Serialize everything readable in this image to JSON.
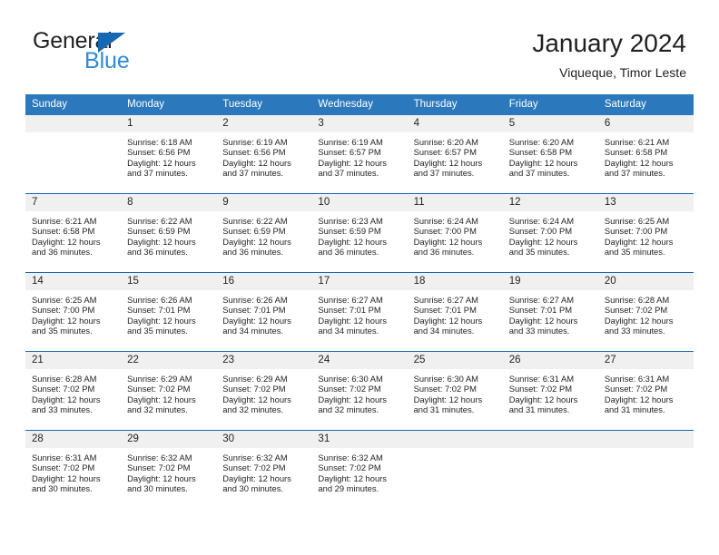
{
  "brand": {
    "name_part1": "General",
    "name_part2": "Blue",
    "logo_icon": "blue-triangle-icon",
    "accent_color": "#2e8ad6",
    "triangle_color": "#1668b3"
  },
  "header": {
    "title": "January 2024",
    "subtitle": "Viqueque, Timor Leste"
  },
  "calendar": {
    "header_bg": "#2b79bc",
    "header_text_color": "#ffffff",
    "daynum_bg": "#f0f0f0",
    "week_divider_color": "#1868b0",
    "weekday_headers": [
      "Sunday",
      "Monday",
      "Tuesday",
      "Wednesday",
      "Thursday",
      "Friday",
      "Saturday"
    ],
    "weeks": [
      [
        {
          "day": "",
          "sunrise": "",
          "sunset": "",
          "daylight_line1": "",
          "daylight_line2": ""
        },
        {
          "day": "1",
          "sunrise": "Sunrise: 6:18 AM",
          "sunset": "Sunset: 6:56 PM",
          "daylight_line1": "Daylight: 12 hours",
          "daylight_line2": "and 37 minutes."
        },
        {
          "day": "2",
          "sunrise": "Sunrise: 6:19 AM",
          "sunset": "Sunset: 6:56 PM",
          "daylight_line1": "Daylight: 12 hours",
          "daylight_line2": "and 37 minutes."
        },
        {
          "day": "3",
          "sunrise": "Sunrise: 6:19 AM",
          "sunset": "Sunset: 6:57 PM",
          "daylight_line1": "Daylight: 12 hours",
          "daylight_line2": "and 37 minutes."
        },
        {
          "day": "4",
          "sunrise": "Sunrise: 6:20 AM",
          "sunset": "Sunset: 6:57 PM",
          "daylight_line1": "Daylight: 12 hours",
          "daylight_line2": "and 37 minutes."
        },
        {
          "day": "5",
          "sunrise": "Sunrise: 6:20 AM",
          "sunset": "Sunset: 6:58 PM",
          "daylight_line1": "Daylight: 12 hours",
          "daylight_line2": "and 37 minutes."
        },
        {
          "day": "6",
          "sunrise": "Sunrise: 6:21 AM",
          "sunset": "Sunset: 6:58 PM",
          "daylight_line1": "Daylight: 12 hours",
          "daylight_line2": "and 37 minutes."
        }
      ],
      [
        {
          "day": "7",
          "sunrise": "Sunrise: 6:21 AM",
          "sunset": "Sunset: 6:58 PM",
          "daylight_line1": "Daylight: 12 hours",
          "daylight_line2": "and 36 minutes."
        },
        {
          "day": "8",
          "sunrise": "Sunrise: 6:22 AM",
          "sunset": "Sunset: 6:59 PM",
          "daylight_line1": "Daylight: 12 hours",
          "daylight_line2": "and 36 minutes."
        },
        {
          "day": "9",
          "sunrise": "Sunrise: 6:22 AM",
          "sunset": "Sunset: 6:59 PM",
          "daylight_line1": "Daylight: 12 hours",
          "daylight_line2": "and 36 minutes."
        },
        {
          "day": "10",
          "sunrise": "Sunrise: 6:23 AM",
          "sunset": "Sunset: 6:59 PM",
          "daylight_line1": "Daylight: 12 hours",
          "daylight_line2": "and 36 minutes."
        },
        {
          "day": "11",
          "sunrise": "Sunrise: 6:24 AM",
          "sunset": "Sunset: 7:00 PM",
          "daylight_line1": "Daylight: 12 hours",
          "daylight_line2": "and 36 minutes."
        },
        {
          "day": "12",
          "sunrise": "Sunrise: 6:24 AM",
          "sunset": "Sunset: 7:00 PM",
          "daylight_line1": "Daylight: 12 hours",
          "daylight_line2": "and 35 minutes."
        },
        {
          "day": "13",
          "sunrise": "Sunrise: 6:25 AM",
          "sunset": "Sunset: 7:00 PM",
          "daylight_line1": "Daylight: 12 hours",
          "daylight_line2": "and 35 minutes."
        }
      ],
      [
        {
          "day": "14",
          "sunrise": "Sunrise: 6:25 AM",
          "sunset": "Sunset: 7:00 PM",
          "daylight_line1": "Daylight: 12 hours",
          "daylight_line2": "and 35 minutes."
        },
        {
          "day": "15",
          "sunrise": "Sunrise: 6:26 AM",
          "sunset": "Sunset: 7:01 PM",
          "daylight_line1": "Daylight: 12 hours",
          "daylight_line2": "and 35 minutes."
        },
        {
          "day": "16",
          "sunrise": "Sunrise: 6:26 AM",
          "sunset": "Sunset: 7:01 PM",
          "daylight_line1": "Daylight: 12 hours",
          "daylight_line2": "and 34 minutes."
        },
        {
          "day": "17",
          "sunrise": "Sunrise: 6:27 AM",
          "sunset": "Sunset: 7:01 PM",
          "daylight_line1": "Daylight: 12 hours",
          "daylight_line2": "and 34 minutes."
        },
        {
          "day": "18",
          "sunrise": "Sunrise: 6:27 AM",
          "sunset": "Sunset: 7:01 PM",
          "daylight_line1": "Daylight: 12 hours",
          "daylight_line2": "and 34 minutes."
        },
        {
          "day": "19",
          "sunrise": "Sunrise: 6:27 AM",
          "sunset": "Sunset: 7:01 PM",
          "daylight_line1": "Daylight: 12 hours",
          "daylight_line2": "and 33 minutes."
        },
        {
          "day": "20",
          "sunrise": "Sunrise: 6:28 AM",
          "sunset": "Sunset: 7:02 PM",
          "daylight_line1": "Daylight: 12 hours",
          "daylight_line2": "and 33 minutes."
        }
      ],
      [
        {
          "day": "21",
          "sunrise": "Sunrise: 6:28 AM",
          "sunset": "Sunset: 7:02 PM",
          "daylight_line1": "Daylight: 12 hours",
          "daylight_line2": "and 33 minutes."
        },
        {
          "day": "22",
          "sunrise": "Sunrise: 6:29 AM",
          "sunset": "Sunset: 7:02 PM",
          "daylight_line1": "Daylight: 12 hours",
          "daylight_line2": "and 32 minutes."
        },
        {
          "day": "23",
          "sunrise": "Sunrise: 6:29 AM",
          "sunset": "Sunset: 7:02 PM",
          "daylight_line1": "Daylight: 12 hours",
          "daylight_line2": "and 32 minutes."
        },
        {
          "day": "24",
          "sunrise": "Sunrise: 6:30 AM",
          "sunset": "Sunset: 7:02 PM",
          "daylight_line1": "Daylight: 12 hours",
          "daylight_line2": "and 32 minutes."
        },
        {
          "day": "25",
          "sunrise": "Sunrise: 6:30 AM",
          "sunset": "Sunset: 7:02 PM",
          "daylight_line1": "Daylight: 12 hours",
          "daylight_line2": "and 31 minutes."
        },
        {
          "day": "26",
          "sunrise": "Sunrise: 6:31 AM",
          "sunset": "Sunset: 7:02 PM",
          "daylight_line1": "Daylight: 12 hours",
          "daylight_line2": "and 31 minutes."
        },
        {
          "day": "27",
          "sunrise": "Sunrise: 6:31 AM",
          "sunset": "Sunset: 7:02 PM",
          "daylight_line1": "Daylight: 12 hours",
          "daylight_line2": "and 31 minutes."
        }
      ],
      [
        {
          "day": "28",
          "sunrise": "Sunrise: 6:31 AM",
          "sunset": "Sunset: 7:02 PM",
          "daylight_line1": "Daylight: 12 hours",
          "daylight_line2": "and 30 minutes."
        },
        {
          "day": "29",
          "sunrise": "Sunrise: 6:32 AM",
          "sunset": "Sunset: 7:02 PM",
          "daylight_line1": "Daylight: 12 hours",
          "daylight_line2": "and 30 minutes."
        },
        {
          "day": "30",
          "sunrise": "Sunrise: 6:32 AM",
          "sunset": "Sunset: 7:02 PM",
          "daylight_line1": "Daylight: 12 hours",
          "daylight_line2": "and 30 minutes."
        },
        {
          "day": "31",
          "sunrise": "Sunrise: 6:32 AM",
          "sunset": "Sunset: 7:02 PM",
          "daylight_line1": "Daylight: 12 hours",
          "daylight_line2": "and 29 minutes."
        },
        {
          "day": "",
          "sunrise": "",
          "sunset": "",
          "daylight_line1": "",
          "daylight_line2": ""
        },
        {
          "day": "",
          "sunrise": "",
          "sunset": "",
          "daylight_line1": "",
          "daylight_line2": ""
        },
        {
          "day": "",
          "sunrise": "",
          "sunset": "",
          "daylight_line1": "",
          "daylight_line2": ""
        }
      ]
    ]
  }
}
